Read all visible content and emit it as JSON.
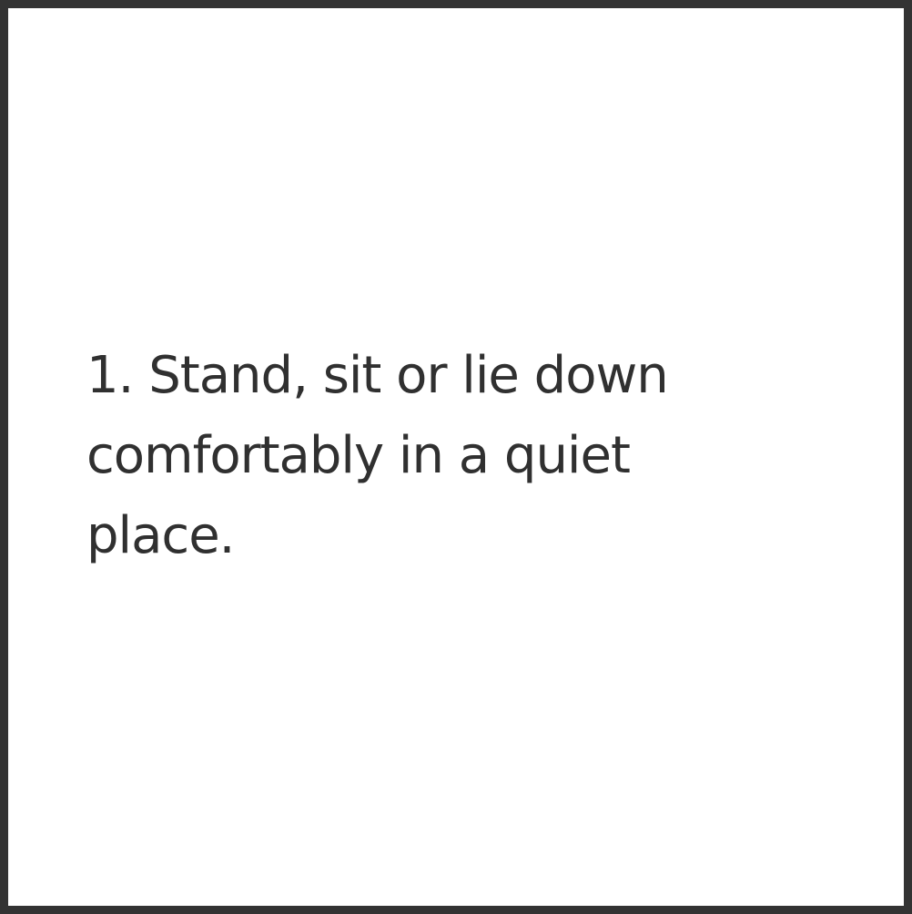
{
  "card": {
    "lines": [
      "1. Stand, sit or lie down",
      "comfortably in a quiet",
      "place."
    ]
  },
  "colors": {
    "border": "#333333",
    "text": "#303030",
    "background": "#ffffff"
  }
}
